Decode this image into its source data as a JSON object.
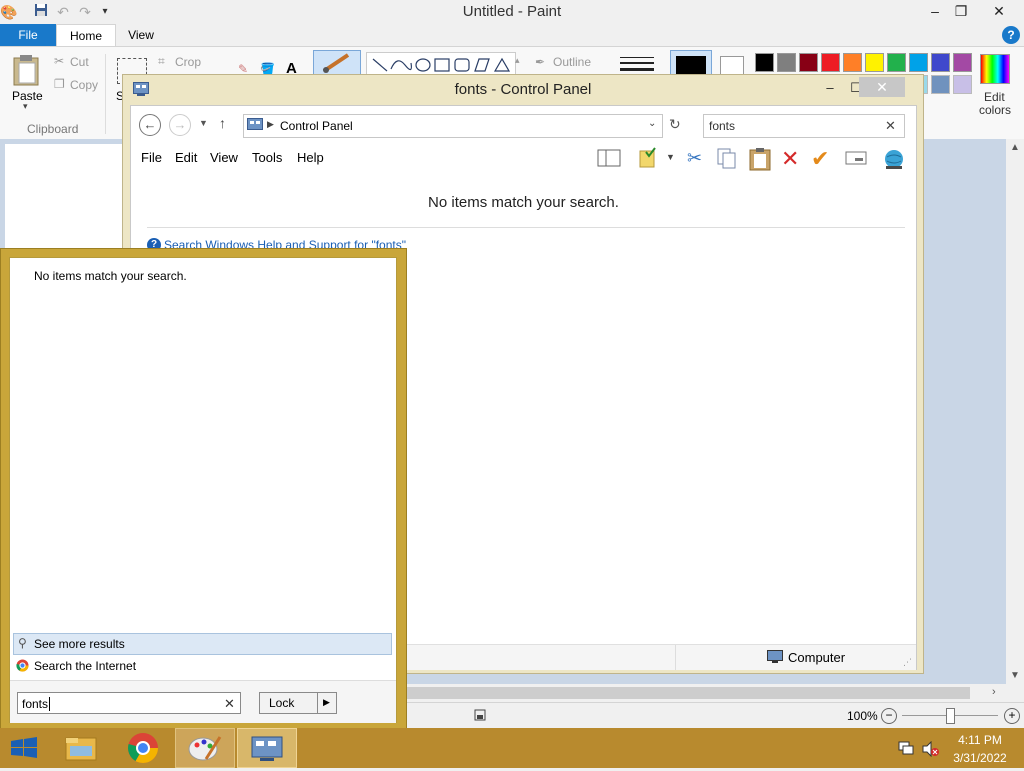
{
  "paint": {
    "title": "Untitled - Paint",
    "tabs": {
      "file": "File",
      "home": "Home",
      "view": "View"
    },
    "ribbon": {
      "paste": "Paste",
      "cut": "Cut",
      "copy": "Copy",
      "crop": "Crop",
      "clipboard_group": "Clipboard",
      "select_partial": "S",
      "outline": "Outline",
      "edit_colors_line1": "Edit",
      "edit_colors_line2": "colors"
    },
    "zoom": "100%",
    "palette_row1": [
      "#000000",
      "#7f7f7f",
      "#880015",
      "#ed1c24",
      "#ff7f27",
      "#fff200",
      "#22b14c",
      "#00a2e8",
      "#3f48cc",
      "#a349a4"
    ],
    "palette_row2": [
      "#ffffff",
      "#c3c3c3",
      "#b97a57",
      "#ffaec9",
      "#ffc90e",
      "#efe4b0",
      "#b5e61d",
      "#99d9ea",
      "#7092be",
      "#c8bfe7"
    ]
  },
  "control_panel": {
    "title": "fonts - Control Panel",
    "address": "Control Panel",
    "search_value": "fonts",
    "menu": [
      "File",
      "Edit",
      "View",
      "Tools",
      "Help"
    ],
    "no_items": "No items match your search.",
    "help_link": "Search Windows Help and Support for \"fonts\"",
    "status_location": "Computer"
  },
  "start_search": {
    "no_items": "No items match your search.",
    "see_more": "See more results",
    "search_internet": "Search the Internet",
    "query": "fonts",
    "lock_label": "Lock"
  },
  "taskbar": {
    "time": "4:11 PM",
    "date": "3/31/2022",
    "apps": [
      "start-button",
      "file-explorer",
      "chrome",
      "paint",
      "control-panel"
    ]
  }
}
